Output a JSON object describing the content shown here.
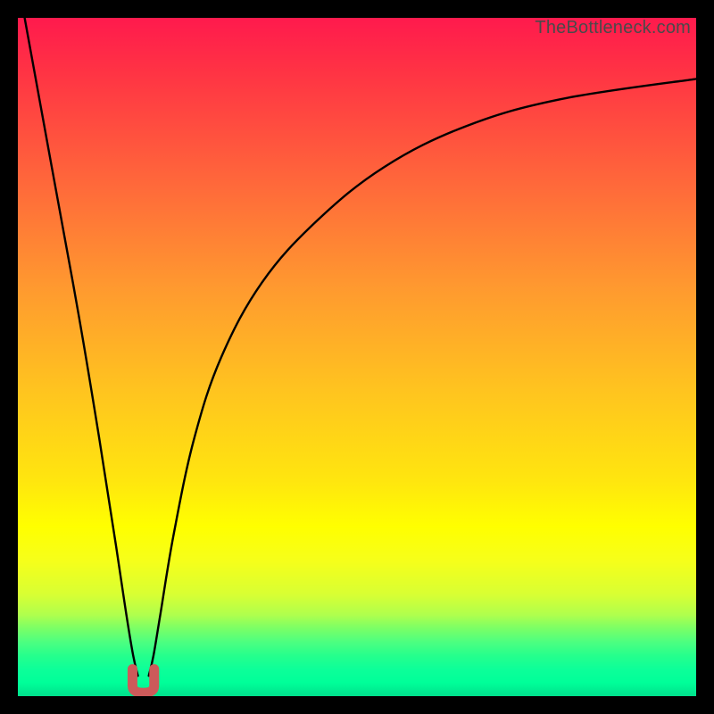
{
  "watermark": "TheBottleneck.com",
  "colors": {
    "frame": "#000000",
    "curve": "#000000",
    "marker": "#cc5a5a",
    "gradient_top": "#ff1a4d",
    "gradient_bottom": "#00e08c"
  },
  "chart_data": {
    "type": "line",
    "title": "",
    "xlabel": "",
    "ylabel": "",
    "xlim": [
      0,
      100
    ],
    "ylim": [
      0,
      100
    ],
    "grid": false,
    "legend": false,
    "series": [
      {
        "name": "left-branch",
        "x": [
          1,
          5,
          9,
          12,
          14.5,
          16,
          17,
          17.7
        ],
        "values": [
          100,
          78,
          56,
          38,
          22,
          12,
          6,
          3
        ]
      },
      {
        "name": "right-branch",
        "x": [
          19.3,
          20,
          21,
          23,
          26,
          30,
          36,
          44,
          54,
          66,
          80,
          100
        ],
        "values": [
          3,
          6,
          12,
          24,
          38,
          50,
          61,
          70,
          78,
          84,
          88,
          91
        ]
      }
    ],
    "marker": {
      "shape": "u",
      "x_center": 18.5,
      "x_half_width": 1.6,
      "y_bottom": 0.5,
      "y_top": 4
    }
  }
}
